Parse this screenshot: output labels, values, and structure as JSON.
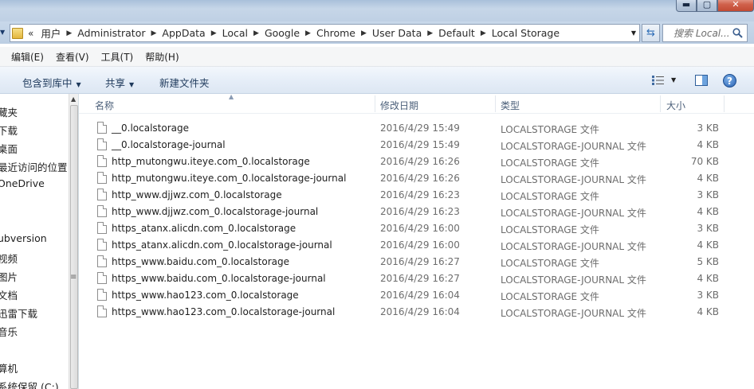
{
  "window": {
    "controls": {
      "minimize": "▬",
      "maximize": "▢",
      "close": "✕"
    }
  },
  "address": {
    "overflow": "«",
    "crumbs": [
      "用户",
      "Administrator",
      "AppData",
      "Local",
      "Google",
      "Chrome",
      "User Data",
      "Default",
      "Local Storage"
    ],
    "search_placeholder": "搜索 Local..."
  },
  "menu": [
    "编辑(E)",
    "查看(V)",
    "工具(T)",
    "帮助(H)"
  ],
  "toolbar": {
    "include_library": "包含到库中",
    "share": "共享",
    "new_folder": "新建文件夹",
    "help": "?"
  },
  "nav": {
    "items": [
      "藏夹",
      "下载",
      "桌面",
      "最近访问的位置",
      "OneDrive",
      "ubversion",
      "视频",
      "图片",
      "文档",
      "迅雷下载",
      "音乐",
      "算机",
      "系统保留 (C:)"
    ]
  },
  "columns": {
    "name": "名称",
    "date": "修改日期",
    "type": "类型",
    "size": "大小"
  },
  "files": [
    {
      "name": "__0.localstorage",
      "date": "2016/4/29 15:49",
      "type": "LOCALSTORAGE 文件",
      "size": "3 KB"
    },
    {
      "name": "__0.localstorage-journal",
      "date": "2016/4/29 15:49",
      "type": "LOCALSTORAGE-JOURNAL 文件",
      "size": "4 KB"
    },
    {
      "name": "http_mutongwu.iteye.com_0.localstorage",
      "date": "2016/4/29 16:26",
      "type": "LOCALSTORAGE 文件",
      "size": "70 KB"
    },
    {
      "name": "http_mutongwu.iteye.com_0.localstorage-journal",
      "date": "2016/4/29 16:26",
      "type": "LOCALSTORAGE-JOURNAL 文件",
      "size": "4 KB"
    },
    {
      "name": "http_www.djjwz.com_0.localstorage",
      "date": "2016/4/29 16:23",
      "type": "LOCALSTORAGE 文件",
      "size": "3 KB"
    },
    {
      "name": "http_www.djjwz.com_0.localstorage-journal",
      "date": "2016/4/29 16:23",
      "type": "LOCALSTORAGE-JOURNAL 文件",
      "size": "4 KB"
    },
    {
      "name": "https_atanx.alicdn.com_0.localstorage",
      "date": "2016/4/29 16:00",
      "type": "LOCALSTORAGE 文件",
      "size": "3 KB"
    },
    {
      "name": "https_atanx.alicdn.com_0.localstorage-journal",
      "date": "2016/4/29 16:00",
      "type": "LOCALSTORAGE-JOURNAL 文件",
      "size": "4 KB"
    },
    {
      "name": "https_www.baidu.com_0.localstorage",
      "date": "2016/4/29 16:27",
      "type": "LOCALSTORAGE 文件",
      "size": "5 KB"
    },
    {
      "name": "https_www.baidu.com_0.localstorage-journal",
      "date": "2016/4/29 16:27",
      "type": "LOCALSTORAGE-JOURNAL 文件",
      "size": "4 KB"
    },
    {
      "name": "https_www.hao123.com_0.localstorage",
      "date": "2016/4/29 16:04",
      "type": "LOCALSTORAGE 文件",
      "size": "3 KB"
    },
    {
      "name": "https_www.hao123.com_0.localstorage-journal",
      "date": "2016/4/29 16:04",
      "type": "LOCALSTORAGE-JOURNAL 文件",
      "size": "4 KB"
    }
  ]
}
